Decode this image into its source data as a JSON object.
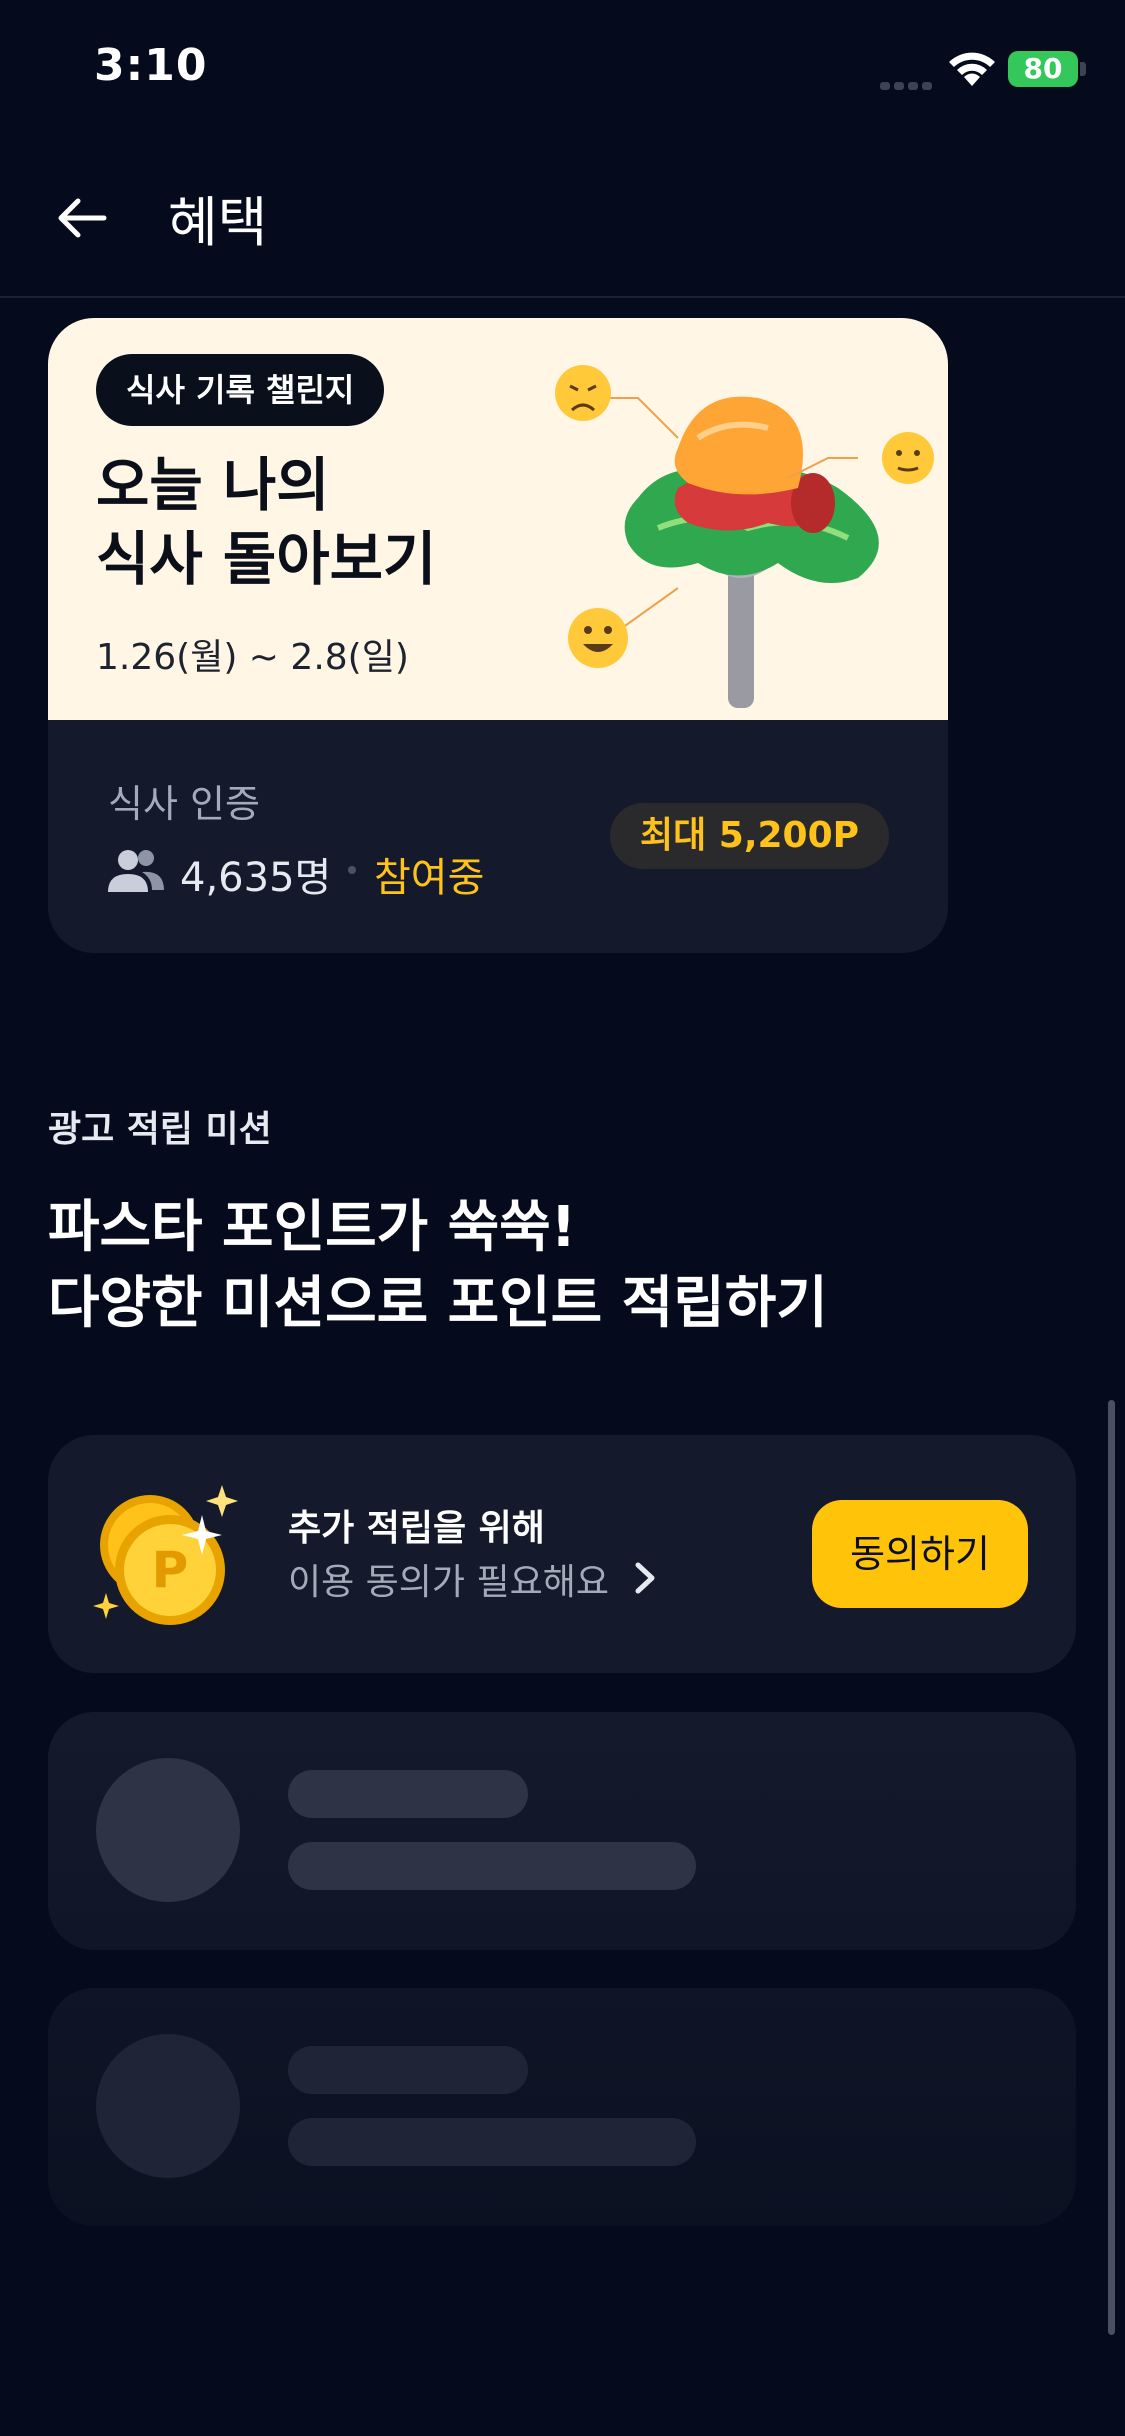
{
  "status_bar": {
    "time": "3:10",
    "battery": "80"
  },
  "nav": {
    "title": "혜택"
  },
  "challenge": {
    "tag": "식사 기록 챌린지",
    "title_line1": "오늘 나의",
    "title_line2": "식사 돌아보기",
    "date_range": "1.26(월) ~ 2.8(일)",
    "label": "식사 인증",
    "participants": "4,635명",
    "status": "참여중",
    "reward": "최대 5,200P"
  },
  "missions": {
    "section_label": "광고 적립 미션",
    "headline_line1": "파스타 포인트가 쑥쑥!",
    "headline_line2": "다양한 미션으로 포인트 적립하기",
    "consent_card": {
      "title": "추가 적립을 위해",
      "subtitle": "이용 동의가 필요해요",
      "button_label": "동의하기"
    }
  },
  "colors": {
    "background": "#050b1c",
    "card": "#141a2b",
    "accent_yellow": "#ffc40a",
    "challenge_banner": "#fff6e6",
    "battery_green": "#34c759"
  }
}
